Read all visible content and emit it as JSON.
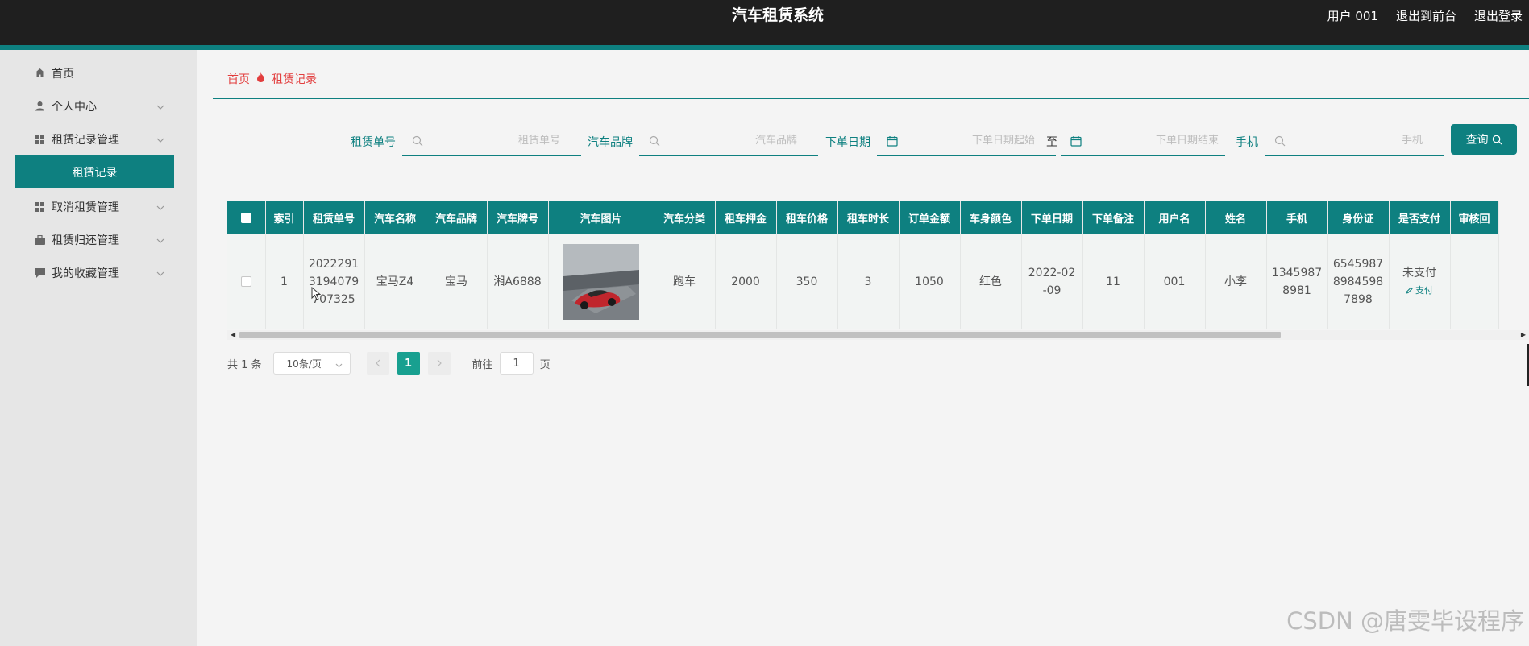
{
  "header": {
    "title": "汽车租赁系统",
    "user": "用户 001",
    "back_front": "退出到前台",
    "logout": "退出登录"
  },
  "sidebar": {
    "items": [
      {
        "label": "首页",
        "icon": "home-icon"
      },
      {
        "label": "个人中心",
        "icon": "user-icon"
      },
      {
        "label": "租赁记录管理",
        "icon": "grid-icon"
      },
      {
        "label": "取消租赁管理",
        "icon": "grid-icon"
      },
      {
        "label": "租赁归还管理",
        "icon": "briefcase-icon"
      },
      {
        "label": "我的收藏管理",
        "icon": "message-icon"
      }
    ],
    "active_sub": "租赁记录"
  },
  "breadcrumb": {
    "home": "首页",
    "current": "租赁记录"
  },
  "search": {
    "order_no_label": "租赁单号",
    "order_no_placeholder": "租赁单号",
    "brand_label": "汽车品牌",
    "brand_placeholder": "汽车品牌",
    "date_label": "下单日期",
    "date_start_placeholder": "下单日期起始",
    "date_sep": "至",
    "date_end_placeholder": "下单日期结束",
    "phone_label": "手机",
    "phone_placeholder": "手机",
    "query_label": "查询"
  },
  "table": {
    "columns": [
      "索引",
      "租赁单号",
      "汽车名称",
      "汽车品牌",
      "汽车牌号",
      "汽车图片",
      "汽车分类",
      "租车押金",
      "租车价格",
      "租车时长",
      "订单金额",
      "车身颜色",
      "下单日期",
      "下单备注",
      "用户名",
      "姓名",
      "手机",
      "身份证",
      "是否支付",
      "审核回"
    ],
    "row": {
      "index": "1",
      "order_no": "20222913194079707325",
      "car_name": "宝马Z4",
      "brand": "宝马",
      "plate": "湘A6888",
      "category": "跑车",
      "deposit": "2000",
      "price": "350",
      "duration": "3",
      "amount": "1050",
      "color": "红色",
      "order_date": "2022-02-09",
      "remark": "11",
      "username": "001",
      "name": "小李",
      "phone": "13459878981",
      "id_card": "65459878984598 7898",
      "paid_status": "未支付",
      "pay_action": "支付"
    }
  },
  "pagination": {
    "total": "共 1 条",
    "page_size": "10条/页",
    "current_page": "1",
    "goto_label": "前往",
    "goto_value": "1",
    "page_unit": "页"
  },
  "watermark": "CSDN @唐雯毕设程序",
  "colors": {
    "accent": "#0e8080",
    "header_bg": "#1f1f1f",
    "breadcrumb": "#e23d3d",
    "page_active": "#18a090"
  }
}
